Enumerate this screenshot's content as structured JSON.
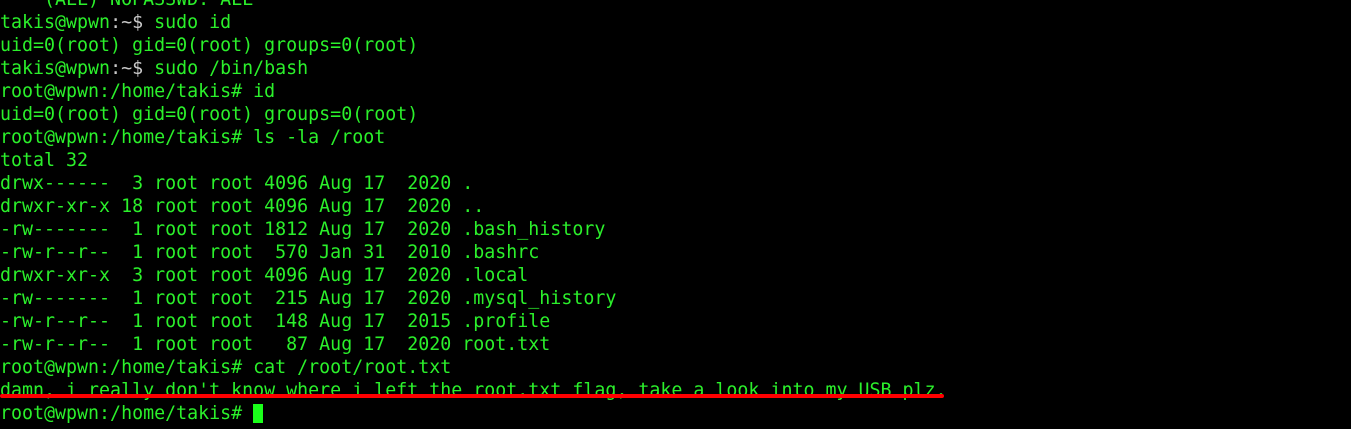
{
  "colors": {
    "background": "#000000",
    "text": "#2bf02b",
    "prompt_path_user": "#c8c8c8",
    "cursor": "#1aff1a",
    "annotation_underline": "#ff0000"
  },
  "terminal": {
    "lines": [
      {
        "kind": "output",
        "text": "    (ALL) NOPASSWD: ALL"
      },
      {
        "kind": "prompt_user",
        "prompt": "takis@wpwn",
        "path": ":~$",
        "command": " sudo id"
      },
      {
        "kind": "output",
        "text": "uid=0(root) gid=0(root) groups=0(root)"
      },
      {
        "kind": "prompt_user",
        "prompt": "takis@wpwn",
        "path": ":~$",
        "command": " sudo /bin/bash"
      },
      {
        "kind": "output",
        "text": "root@wpwn:/home/takis# id"
      },
      {
        "kind": "output",
        "text": "uid=0(root) gid=0(root) groups=0(root)"
      },
      {
        "kind": "output",
        "text": "root@wpwn:/home/takis# ls -la /root"
      },
      {
        "kind": "output",
        "text": "total 32"
      },
      {
        "kind": "output",
        "text": "drwx------  3 root root 4096 Aug 17  2020 ."
      },
      {
        "kind": "output",
        "text": "drwxr-xr-x 18 root root 4096 Aug 17  2020 .."
      },
      {
        "kind": "output",
        "text": "-rw-------  1 root root 1812 Aug 17  2020 .bash_history"
      },
      {
        "kind": "output",
        "text": "-rw-r--r--  1 root root  570 Jan 31  2010 .bashrc"
      },
      {
        "kind": "output",
        "text": "drwxr-xr-x  3 root root 4096 Aug 17  2020 .local"
      },
      {
        "kind": "output",
        "text": "-rw-------  1 root root  215 Aug 17  2020 .mysql_history"
      },
      {
        "kind": "output",
        "text": "-rw-r--r--  1 root root  148 Aug 17  2015 .profile"
      },
      {
        "kind": "output",
        "text": "-rw-r--r--  1 root root   87 Aug 17  2020 root.txt"
      },
      {
        "kind": "output",
        "text": "root@wpwn:/home/takis# cat /root/root.txt"
      },
      {
        "kind": "output",
        "text": "damn, i really don't know where i left the root.txt flag, take a look into my USB plz."
      },
      {
        "kind": "input",
        "text": "root@wpwn:/home/takis# "
      }
    ]
  }
}
